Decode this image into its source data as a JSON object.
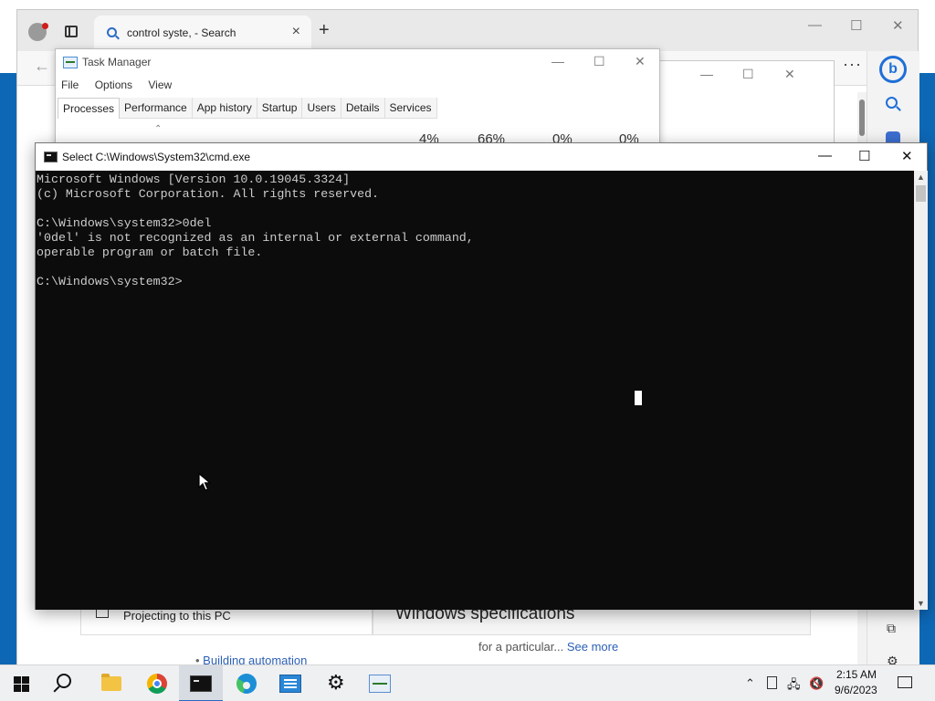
{
  "browser": {
    "tab_title": "control syste, - Search",
    "more_label": "···",
    "sidebar_bing": "b"
  },
  "page": {
    "projecting_label": "Projecting to this PC",
    "spec_title": "Windows specifications",
    "building_link": "Building automation",
    "particular_text": "for a particular...",
    "see_more": "See more"
  },
  "task_manager": {
    "title": "Task Manager",
    "menu": [
      "File",
      "Options",
      "View"
    ],
    "tabs": [
      "Processes",
      "Performance",
      "App history",
      "Startup",
      "Users",
      "Details",
      "Services"
    ],
    "active_tab": "Processes",
    "headers": [
      "4%",
      "66%",
      "0%",
      "0%"
    ]
  },
  "cmd": {
    "title": "Select C:\\Windows\\System32\\cmd.exe",
    "lines": [
      "Microsoft Windows [Version 10.0.19045.3324]",
      "(c) Microsoft Corporation. All rights reserved.",
      "",
      "C:\\Windows\\system32>0del",
      "'0del' is not recognized as an internal or external command,",
      "operable program or batch file.",
      "",
      "C:\\Windows\\system32>"
    ]
  },
  "taskbar": {
    "items": [
      "start",
      "search",
      "file-explorer",
      "chrome",
      "command-prompt",
      "edge",
      "system-information",
      "settings",
      "task-manager"
    ],
    "active_item": "command-prompt",
    "time": "2:15 AM",
    "date": "9/6/2023"
  },
  "icons": {
    "start": "windows-logo-icon",
    "search": "search-icon",
    "explorer": "folder-icon",
    "settings": "gear-icon"
  },
  "colors": {
    "cmd_background": "#0c0c0c",
    "cmd_text": "#cccccc",
    "accent": "#2a69c4",
    "desktop": "#0d67b5"
  }
}
